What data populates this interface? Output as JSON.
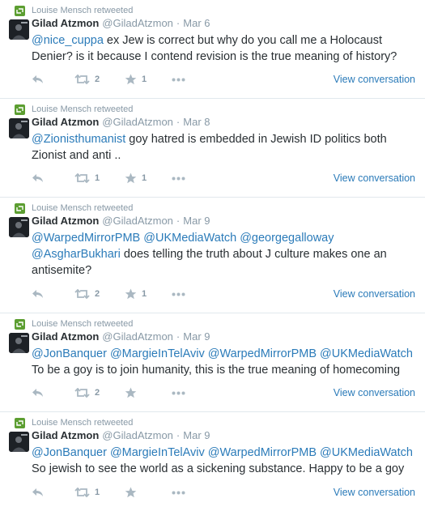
{
  "retweeter_label": "Louise Mensch retweeted",
  "view_conversation": "View conversation",
  "tweets": [
    {
      "fullname": "Gilad Atzmon",
      "username": "@GiladAtzmon",
      "time": "Mar 6",
      "mention": "@nice_cuppa",
      "body": " ex Jew is correct but why do you call me a Holocaust Denier? is it because I contend revision is the true meaning of history?",
      "retweets": "2",
      "favorites": "1"
    },
    {
      "fullname": "Gilad Atzmon",
      "username": "@GiladAtzmon",
      "time": "Mar 8",
      "mention": "@Zionisthumanist",
      "body": " goy hatred is embedded in  Jewish ID politics both Zionist and anti ..",
      "retweets": "1",
      "favorites": "1"
    },
    {
      "fullname": "Gilad Atzmon",
      "username": "@GiladAtzmon",
      "time": "Mar 9",
      "mention": "@WarpedMirrorPMB @UKMediaWatch @georgegalloway @AsgharBukhari",
      "body": " does telling the truth about J culture makes one an antisemite?",
      "retweets": "2",
      "favorites": "1"
    },
    {
      "fullname": "Gilad Atzmon",
      "username": "@GiladAtzmon",
      "time": "Mar 9",
      "mention": "@JonBanquer @MargieInTelAviv @WarpedMirrorPMB @UKMediaWatch",
      "body": " To be a goy is to join humanity, this is the true meaning of homecoming",
      "retweets": "2",
      "favorites": ""
    },
    {
      "fullname": "Gilad Atzmon",
      "username": "@GiladAtzmon",
      "time": "Mar 9",
      "mention": "@JonBanquer @MargieInTelAviv @WarpedMirrorPMB @UKMediaWatch",
      "body": " So jewish to see the world as a sickening substance. Happy to be a goy",
      "retweets": "1",
      "favorites": ""
    }
  ],
  "icons": {
    "retweeted": "retweet-icon",
    "reply": "reply-icon",
    "retweet": "retweet-icon",
    "favorite": "star-icon",
    "more": "more-icon",
    "avatar": "avatar"
  },
  "colors": {
    "link": "#2b7bb9",
    "muted": "#8899a6",
    "retweet_badge": "#5c9e31",
    "divider": "#e1e8ed"
  }
}
